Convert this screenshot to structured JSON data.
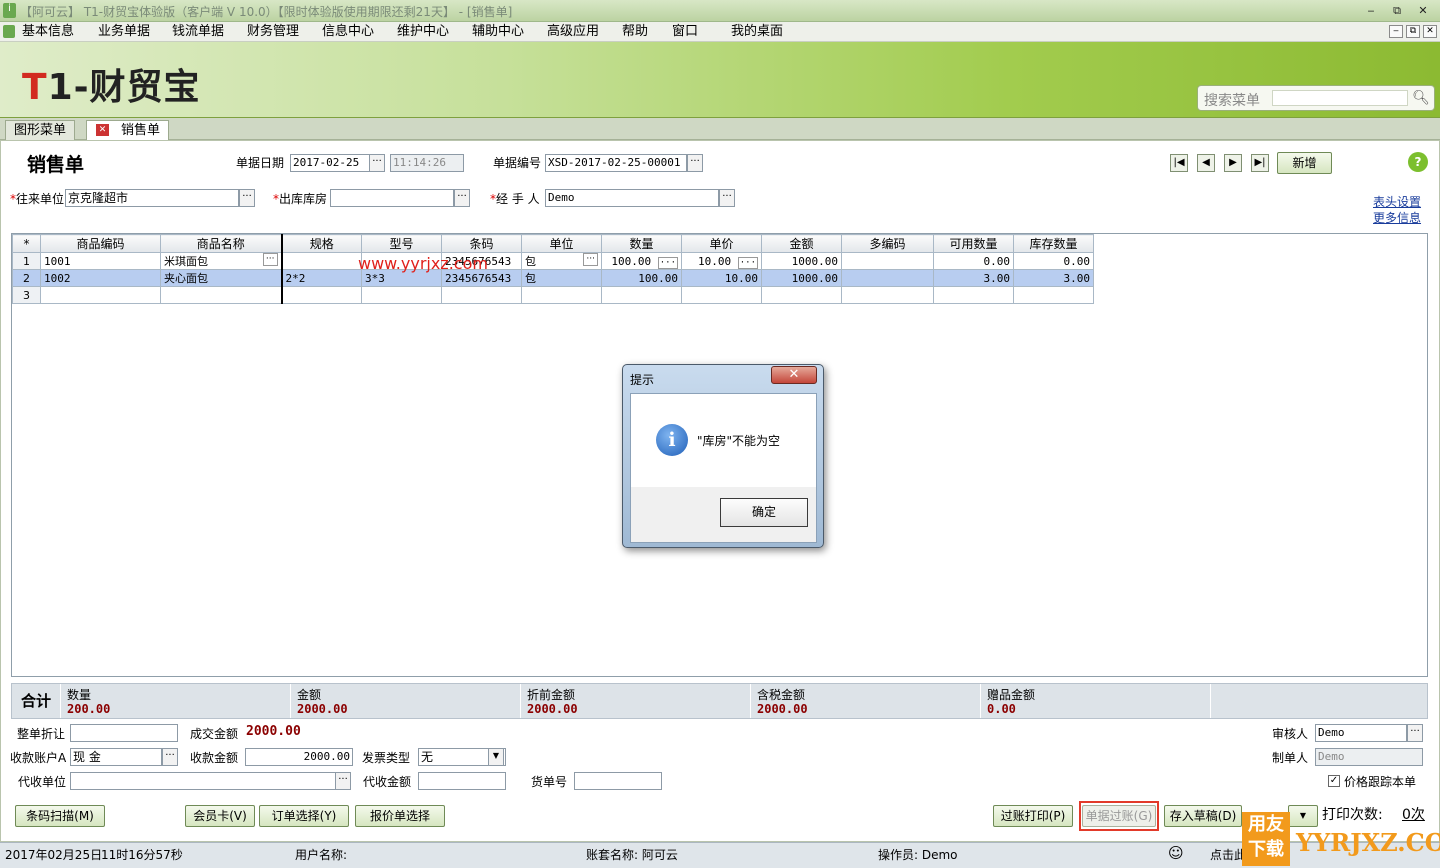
{
  "window": {
    "title": "【阿可云】 T1-财贸宝体验版（客户端 V 10.0）【限时体验版使用期限还剩21天】 - [销售单]",
    "min": "‒",
    "restore": "⧉",
    "close": "✕"
  },
  "menu": {
    "items": [
      "基本信息",
      "业务单据",
      "钱流单据",
      "财务管理",
      "信息中心",
      "维护中心",
      "辅助中心",
      "高级应用",
      "帮助",
      "窗口",
      "我的桌面"
    ]
  },
  "banner": {
    "logo_t": "T",
    "logo_rest": "1-财贸宝",
    "search_label": "搜索菜单",
    "search_value": ""
  },
  "tabs": [
    "图形菜单",
    "销售单"
  ],
  "form": {
    "title": "销售单",
    "date_label": "单据日期",
    "date": "2017-02-25",
    "time": "11:14:26",
    "no_label": "单据编号",
    "no": "XSD-2017-02-25-00001",
    "new_btn": "新增",
    "partner_label": "往来单位",
    "partner": "京克隆超市",
    "warehouse_label": "出库库房",
    "warehouse": "",
    "handler_label": "经  手  人",
    "handler": "Demo",
    "link1": "表头设置",
    "link2": "更多信息",
    "help": "?"
  },
  "grid": {
    "headers": [
      "*",
      "商品编码",
      "商品名称",
      "规格",
      "型号",
      "条码",
      "单位",
      "数量",
      "单价",
      "金额",
      "多编码",
      "可用数量",
      "库存数量"
    ],
    "rows": [
      [
        "1",
        "1001",
        "米琪面包",
        "",
        "",
        "2345676543",
        "包",
        "100.00",
        "10.00",
        "1000.00",
        "",
        "0.00",
        "0.00"
      ],
      [
        "2",
        "1002",
        "夹心面包",
        "2*2",
        "3*3",
        "2345676543",
        "包",
        "100.00",
        "10.00",
        "1000.00",
        "",
        "3.00",
        "3.00"
      ],
      [
        "3",
        "",
        "",
        "",
        "",
        "",
        "",
        "",
        "",
        "",
        "",
        "",
        ""
      ]
    ]
  },
  "watermark": "www.yyrjxz.com",
  "summary": {
    "head": "合计",
    "items": [
      {
        "k": "数量",
        "v": "200.00"
      },
      {
        "k": "金额",
        "v": "2000.00"
      },
      {
        "k": "折前金额",
        "v": "2000.00"
      },
      {
        "k": "含税金额",
        "v": "2000.00"
      },
      {
        "k": "赠品金额",
        "v": "0.00"
      }
    ]
  },
  "bottom": {
    "discount_label": "整单折让",
    "deal_label": "成交金额",
    "deal": "2000.00",
    "account_label": "收款账户A",
    "account": "现      金",
    "recv_label": "收款金额",
    "recv": "2000.00",
    "invoice_label": "发票类型",
    "invoice": "无",
    "agent_label": "代收单位",
    "agentamt_label": "代收金额",
    "cargo_label": "货单号",
    "auditor_label": "审核人",
    "auditor": "Demo",
    "maker_label": "制单人",
    "maker": "Demo",
    "track_label": "价格跟踪本单",
    "btns": [
      "条码扫描(M)",
      "会员卡(V)",
      "订单选择(Y)",
      "报价单选择",
      "过账打印(P)",
      "单据过账(G)",
      "存入草稿(D)"
    ],
    "print_label": "打印次数:",
    "print_count": "0次"
  },
  "dialog": {
    "title": "提示",
    "msg": "\"库房\"不能为空",
    "ok": "确定",
    "close": "✕"
  },
  "status": {
    "date": "2017年02月25日",
    "time": "11时16分57秒",
    "user_label": "用户名称:",
    "set_label": "账套名称: 阿可云",
    "op_label": "操作员: Demo",
    "click": "点击此"
  },
  "brand": {
    "a": "用友",
    "b": "下载",
    "c": "YYRJXZ.COM"
  }
}
